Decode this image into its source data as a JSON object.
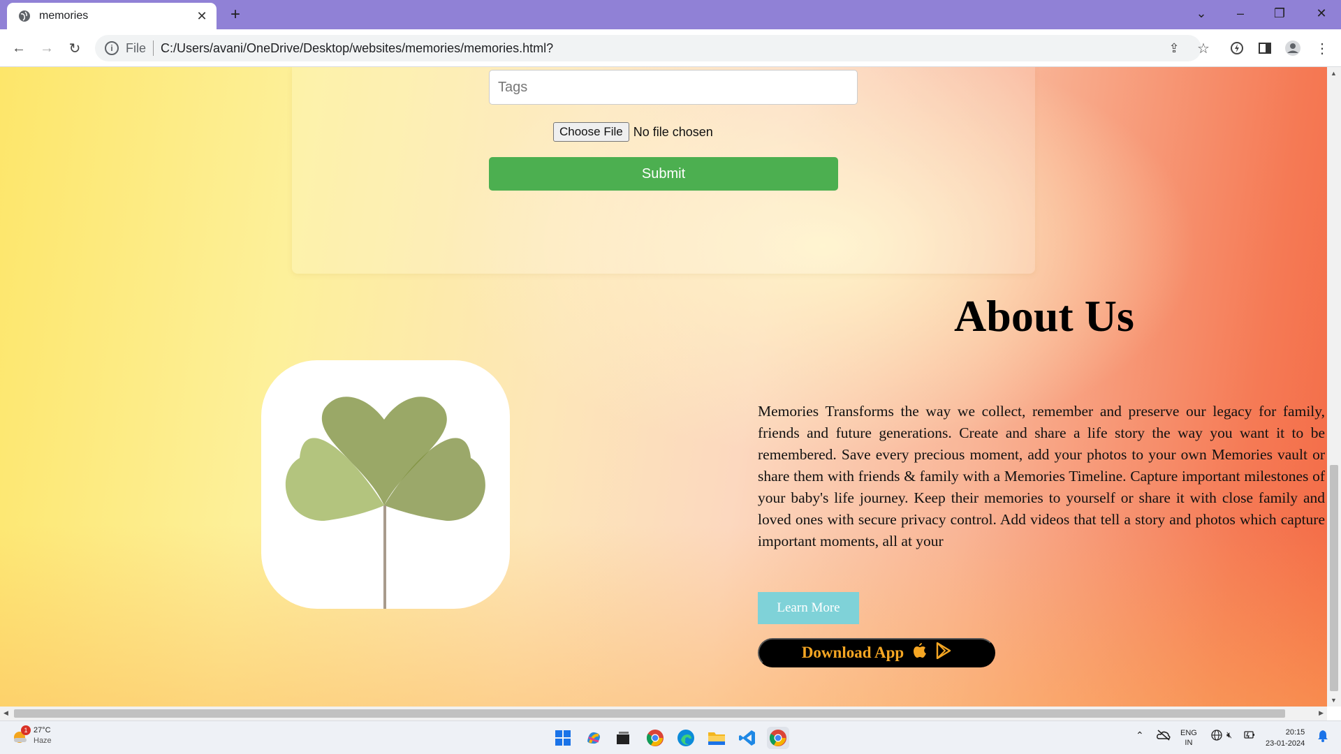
{
  "browser": {
    "tab_title": "memories",
    "url_scheme": "File",
    "url": "C:/Users/avani/OneDrive/Desktop/websites/memories/memories.html?"
  },
  "form": {
    "tags_placeholder": "Tags",
    "choose_file_label": "Choose File",
    "file_status": "No file chosen",
    "submit_label": "Submit"
  },
  "about": {
    "title": "About Us",
    "body": "Memories Transforms the way we collect, remember and preserve our legacy for family, friends and future generations. Create and share a life story the way you want it to be remembered. Save every precious moment, add your photos to your own Memories vault or share them with friends & family with a Memories Timeline. Capture important milestones of your baby's life journey. Keep their memories to yourself or share it with close family and loved ones with secure privacy control. Add videos that tell a story and photos which capture important moments, all at your",
    "learn_more_label": "Learn More",
    "download_label": "Download App"
  },
  "taskbar": {
    "weather_temp": "27°C",
    "weather_desc": "Haze",
    "weather_badge": "1",
    "lang_top": "ENG",
    "lang_bottom": "IN",
    "time": "20:15",
    "date": "23-01-2024"
  },
  "colors": {
    "tabbar": "#9081d6",
    "submit": "#4caf50",
    "learn_more": "#7fd2d8",
    "download_text": "#f5a623"
  }
}
